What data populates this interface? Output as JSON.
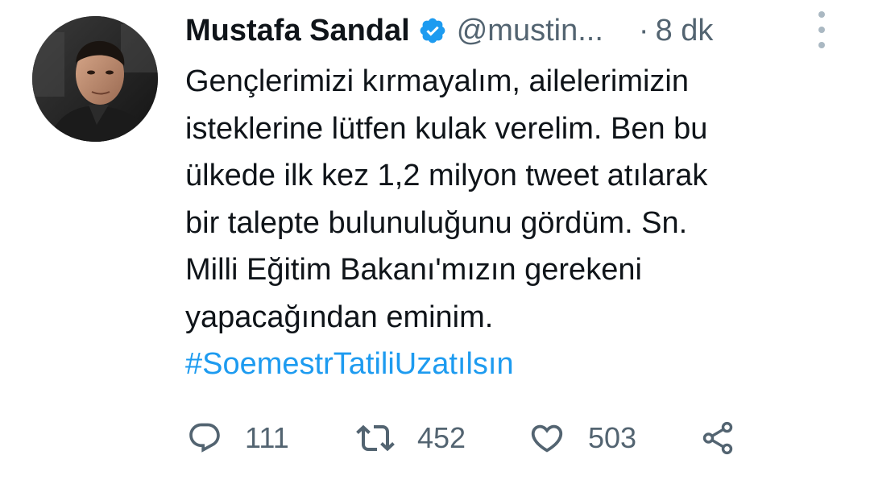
{
  "author": {
    "name": "Mustafa Sandal",
    "handle": "@mustin...",
    "separator": "·",
    "time": "8 dk"
  },
  "tweet": {
    "lines": [
      "Gençlerimizi kırmayalım, ailelerimizin",
      "isteklerine lütfen kulak verelim. Ben bu",
      "ülkede ilk kez 1,2 milyon tweet atılarak",
      "bir talepte bulunuluğunu gördüm. Sn.",
      "Milli Eğitim Bakanı'mızın gerekeni",
      "yapacağından eminim."
    ],
    "hashtag": "#SoemestrTatiliUzatılsın"
  },
  "actions": {
    "reply_count": "111",
    "retweet_count": "452",
    "like_count": "503"
  },
  "icons": {
    "verified": "verified-badge-icon",
    "more": "more-vertical-icon",
    "reply": "reply-bubble-icon",
    "retweet": "retweet-icon",
    "like": "heart-icon",
    "share": "share-icon"
  },
  "colors": {
    "text": "#0f1419",
    "secondary": "#536471",
    "accent": "#1d9bf0"
  }
}
